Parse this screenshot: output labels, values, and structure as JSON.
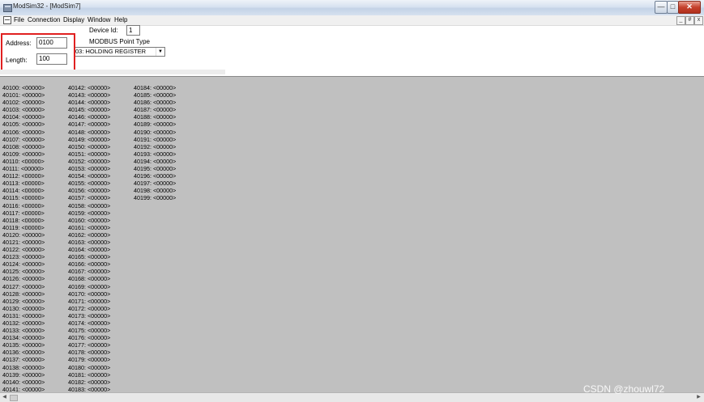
{
  "window": {
    "title": "ModSim32 - [ModSim7]",
    "buttons": {
      "minimize": "—",
      "maximize": "□",
      "close": "✕"
    }
  },
  "menu": {
    "items": [
      "File",
      "Connection",
      "Display",
      "Window",
      "Help"
    ],
    "mdi_buttons": [
      "_",
      "#",
      "x"
    ]
  },
  "form": {
    "device_id_label": "Device Id:",
    "device_id_value": "1",
    "point_type_label": "MODBUS Point Type",
    "point_type_value": "03: HOLDING REGISTER",
    "address_label": "Address:",
    "address_value": "0100",
    "length_label": "Length:",
    "length_value": "100"
  },
  "registers": {
    "columns": [
      [
        "40100: <00000>",
        "40101: <00000>",
        "40102: <00000>",
        "40103: <00000>",
        "40104: <00000>",
        "40105: <00000>",
        "40106: <00000>",
        "40107: <00000>",
        "40108: <00000>",
        "40109: <00000>",
        "40110: <00000>",
        "40111: <00000>",
        "40112: <00000>",
        "40113: <00000>",
        "40114: <00000>",
        "40115: <00000>",
        "40116: <00000>",
        "40117: <00000>",
        "40118: <00000>",
        "40119: <00000>",
        "40120: <00000>",
        "40121: <00000>",
        "40122: <00000>",
        "40123: <00000>",
        "40124: <00000>",
        "40125: <00000>",
        "40126: <00000>",
        "40127: <00000>",
        "40128: <00000>",
        "40129: <00000>",
        "40130: <00000>",
        "40131: <00000>",
        "40132: <00000>",
        "40133: <00000>",
        "40134: <00000>",
        "40135: <00000>",
        "40136: <00000>",
        "40137: <00000>",
        "40138: <00000>",
        "40139: <00000>",
        "40140: <00000>",
        "40141: <00000>"
      ],
      [
        "40142: <00000>",
        "40143: <00000>",
        "40144: <00000>",
        "40145: <00000>",
        "40146: <00000>",
        "40147: <00000>",
        "40148: <00000>",
        "40149: <00000>",
        "40150: <00000>",
        "40151: <00000>",
        "40152: <00000>",
        "40153: <00000>",
        "40154: <00000>",
        "40155: <00000>",
        "40156: <00000>",
        "40157: <00000>",
        "40158: <00000>",
        "40159: <00000>",
        "40160: <00000>",
        "40161: <00000>",
        "40162: <00000>",
        "40163: <00000>",
        "40164: <00000>",
        "40165: <00000>",
        "40166: <00000>",
        "40167: <00000>",
        "40168: <00000>",
        "40169: <00000>",
        "40170: <00000>",
        "40171: <00000>",
        "40172: <00000>",
        "40173: <00000>",
        "40174: <00000>",
        "40175: <00000>",
        "40176: <00000>",
        "40177: <00000>",
        "40178: <00000>",
        "40179: <00000>",
        "40180: <00000>",
        "40181: <00000>",
        "40182: <00000>",
        "40183: <00000>"
      ],
      [
        "40184: <00000>",
        "40185: <00000>",
        "40186: <00000>",
        "40187: <00000>",
        "40188: <00000>",
        "40189: <00000>",
        "40190: <00000>",
        "40191: <00000>",
        "40192: <00000>",
        "40193: <00000>",
        "40194: <00000>",
        "40195: <00000>",
        "40196: <00000>",
        "40197: <00000>",
        "40198: <00000>",
        "40199: <00000>"
      ]
    ]
  },
  "watermark": "CSDN @zhouwl72",
  "colors": {
    "highlight": "#e02020",
    "data_background": "#c0c0c0"
  }
}
